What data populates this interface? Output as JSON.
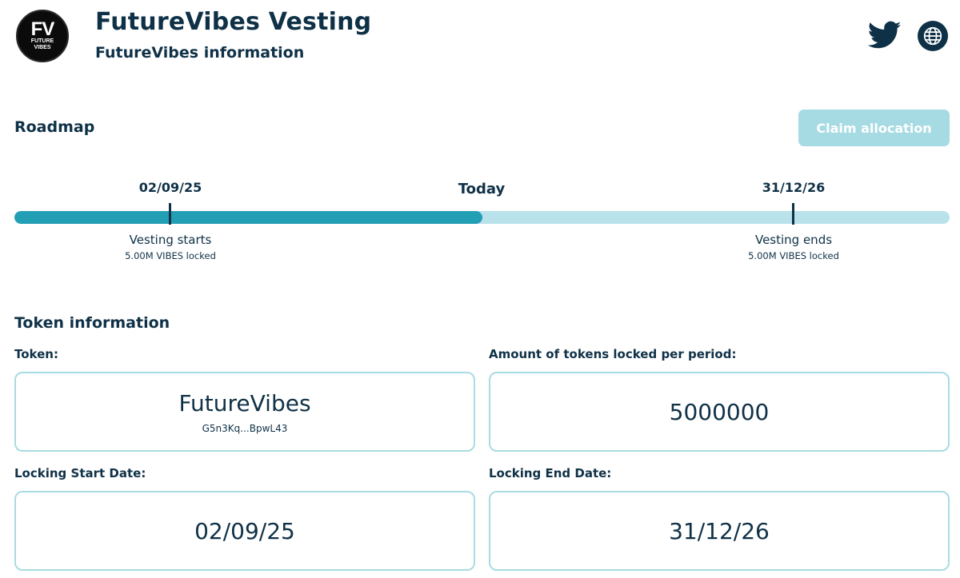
{
  "header": {
    "logo_mono": "FV",
    "logo_line1": "FUTURE",
    "logo_line2": "VIBES",
    "title": "FutureVibes Vesting",
    "subtitle": "FutureVibes information",
    "icons": [
      "twitter-icon",
      "globe-icon"
    ]
  },
  "roadmap": {
    "title": "Roadmap",
    "claim_button": "Claim allocation",
    "progress_fraction": 0.5,
    "start": {
      "date": "02/09/25",
      "label": "Vesting starts",
      "detail": "5.00M VIBES locked"
    },
    "today_label": "Today",
    "end": {
      "date": "31/12/26",
      "label": "Vesting ends",
      "detail": "5.00M VIBES locked"
    },
    "colors": {
      "fill": "#239fb5",
      "track": "#b9e2ea",
      "button": "#a6dbe3"
    }
  },
  "token_info": {
    "title": "Token information",
    "token_label": "Token:",
    "token_name": "FutureVibes",
    "token_address": "G5n3Kq...BpwL43",
    "amount_label": "Amount of tokens locked per period:",
    "amount_value": "5000000",
    "start_label": "Locking Start Date:",
    "start_value": "02/09/25",
    "end_label": "Locking End Date:",
    "end_value": "31/12/26"
  }
}
